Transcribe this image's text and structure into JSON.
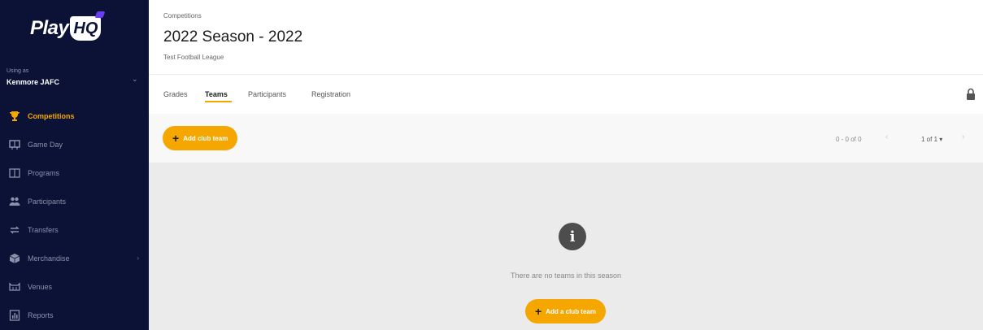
{
  "sidebar": {
    "logo_play": "Play",
    "logo_hq": "HQ",
    "using_as_label": "Using as",
    "club_name": "Kenmore JAFC",
    "items": [
      {
        "label": "Competitions",
        "icon": "trophy-icon",
        "active": true
      },
      {
        "label": "Game Day",
        "icon": "scoreboard-icon"
      },
      {
        "label": "Programs",
        "icon": "book-icon"
      },
      {
        "label": "Participants",
        "icon": "people-icon"
      },
      {
        "label": "Transfers",
        "icon": "transfer-arrows-icon"
      },
      {
        "label": "Merchandise",
        "icon": "box-icon",
        "has_submenu": true
      },
      {
        "label": "Venues",
        "icon": "stadium-icon"
      },
      {
        "label": "Reports",
        "icon": "report-icon"
      }
    ]
  },
  "header": {
    "breadcrumb": "Competitions",
    "title": "2022 Season - 2022",
    "subtitle": "Test Football League"
  },
  "tabs": [
    {
      "label": "Grades"
    },
    {
      "label": "Teams",
      "active": true
    },
    {
      "label": "Participants"
    },
    {
      "label": "Registration"
    }
  ],
  "toolbar": {
    "add_button_label": "Add club team",
    "count_text": "0 - 0 of 0",
    "page_text": "1 of 1"
  },
  "empty_state": {
    "message": "There are no teams in this season",
    "button_label": "Add a club team"
  },
  "colors": {
    "sidebar_bg": "#0b1236",
    "accent": "#f5a700",
    "content_bg": "#ebebeb"
  }
}
